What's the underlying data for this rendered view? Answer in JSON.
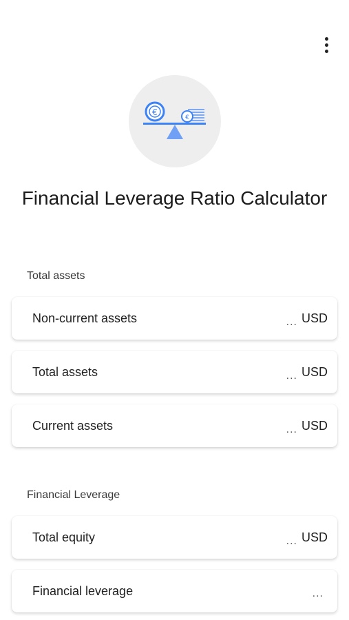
{
  "app": {
    "title": "Financial Leverage Ratio Calculator"
  },
  "icons": {
    "menu": "more-vert-icon",
    "logo": "balance-scale-coins-icon"
  },
  "colors": {
    "accent": "#3b82f6",
    "logo_bg": "#eeeeee"
  },
  "sections": [
    {
      "label": "Total assets",
      "fields": [
        {
          "label": "Non-current assets",
          "placeholder": "...",
          "unit": "USD"
        },
        {
          "label": "Total assets",
          "placeholder": "...",
          "unit": "USD"
        },
        {
          "label": "Current assets",
          "placeholder": "...",
          "unit": "USD"
        }
      ]
    },
    {
      "label": "Financial Leverage",
      "fields": [
        {
          "label": "Total equity",
          "placeholder": "...",
          "unit": "USD"
        },
        {
          "label": "Financial leverage",
          "placeholder": "...",
          "unit": ""
        }
      ]
    }
  ]
}
